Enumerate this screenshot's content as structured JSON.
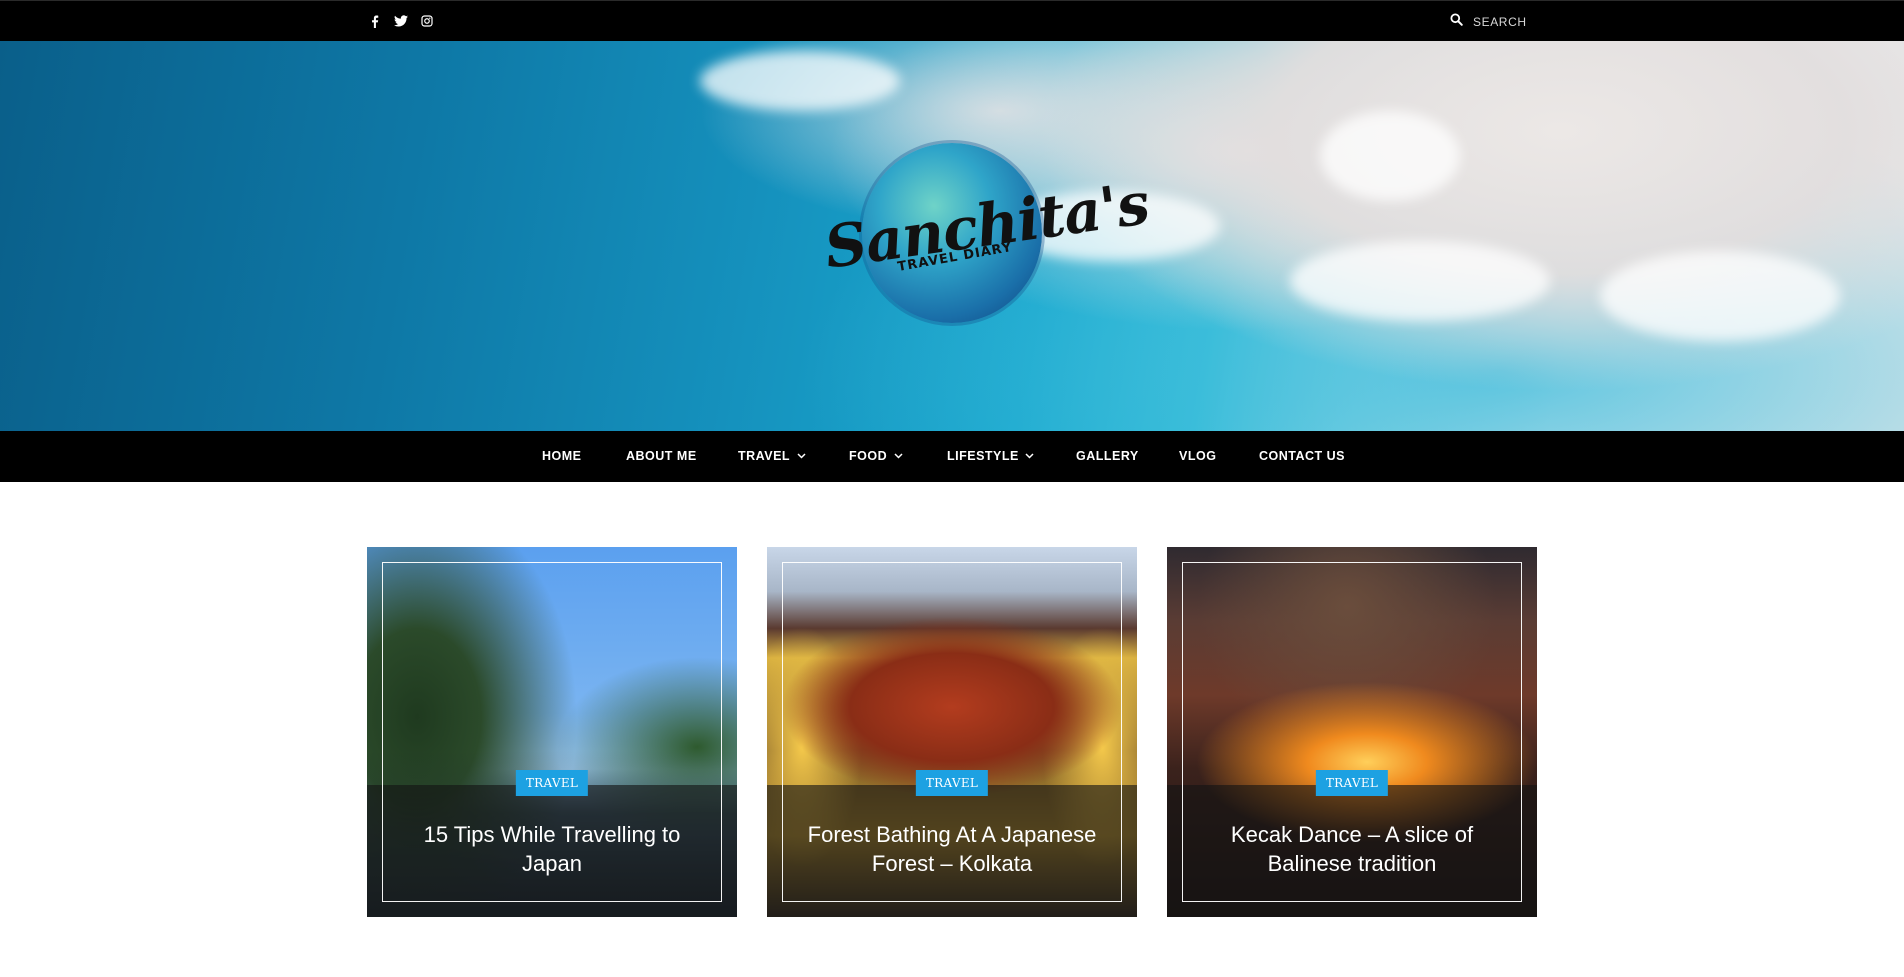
{
  "topbar": {
    "social": [
      {
        "icon": "facebook-icon"
      },
      {
        "icon": "twitter-icon"
      },
      {
        "icon": "instagram-icon"
      }
    ],
    "search_label": "SEARCH"
  },
  "logo": {
    "name": "Sanchita's",
    "tagline": "TRAVEL DIARY"
  },
  "nav": {
    "items": [
      {
        "label": "HOME",
        "has_dropdown": false
      },
      {
        "label": "ABOUT ME",
        "has_dropdown": false
      },
      {
        "label": "TRAVEL",
        "has_dropdown": true
      },
      {
        "label": "FOOD",
        "has_dropdown": true
      },
      {
        "label": "LIFESTYLE",
        "has_dropdown": true
      },
      {
        "label": "GALLERY",
        "has_dropdown": false
      },
      {
        "label": "VLOG",
        "has_dropdown": false
      },
      {
        "label": "CONTACT US",
        "has_dropdown": false
      }
    ]
  },
  "posts": [
    {
      "category": "TRAVEL",
      "title": "15 Tips While Travelling to Japan"
    },
    {
      "category": "TRAVEL",
      "title": "Forest Bathing At A Japanese Forest – Kolkata"
    },
    {
      "category": "TRAVEL",
      "title": "Kecak Dance – A slice of Balinese tradition"
    }
  ],
  "colors": {
    "topbar_bg": "#000000",
    "nav_bg": "#000000",
    "tag_bg": "#1da1e2"
  }
}
